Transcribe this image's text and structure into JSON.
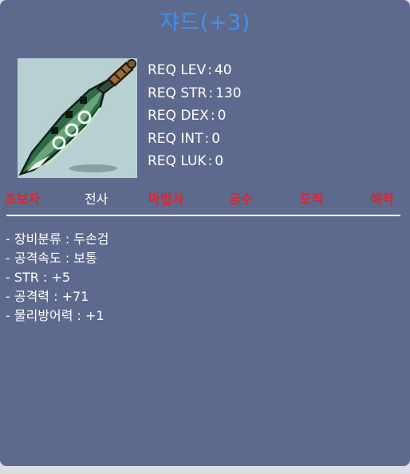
{
  "item": {
    "title": "쟈드(+3)",
    "image": "green-two-handed-sword-icon"
  },
  "requirements": [
    {
      "label": "REQ LEV",
      "value": "40"
    },
    {
      "label": "REQ STR",
      "value": "130"
    },
    {
      "label": "REQ DEX",
      "value": "0"
    },
    {
      "label": "REQ INT",
      "value": "0"
    },
    {
      "label": "REQ LUK",
      "value": "0"
    }
  ],
  "jobs": [
    {
      "label": "초보자",
      "usable": false
    },
    {
      "label": "전사",
      "usable": true
    },
    {
      "label": "마법사",
      "usable": false
    },
    {
      "label": "궁수",
      "usable": false
    },
    {
      "label": "도적",
      "usable": false
    },
    {
      "label": "해적",
      "usable": false
    }
  ],
  "stats": [
    "- 장비분류 : 두손검",
    "- 공격속도 : 보통",
    "- STR : +5",
    "- 공격력 : +71",
    "- 물리방어력 : +1"
  ],
  "colors": {
    "panel_bg": "#5d6a8d",
    "title": "#3f91ee",
    "job_unusable": "#e8202a",
    "job_usable": "#ffffff",
    "text": "#ffffff"
  }
}
